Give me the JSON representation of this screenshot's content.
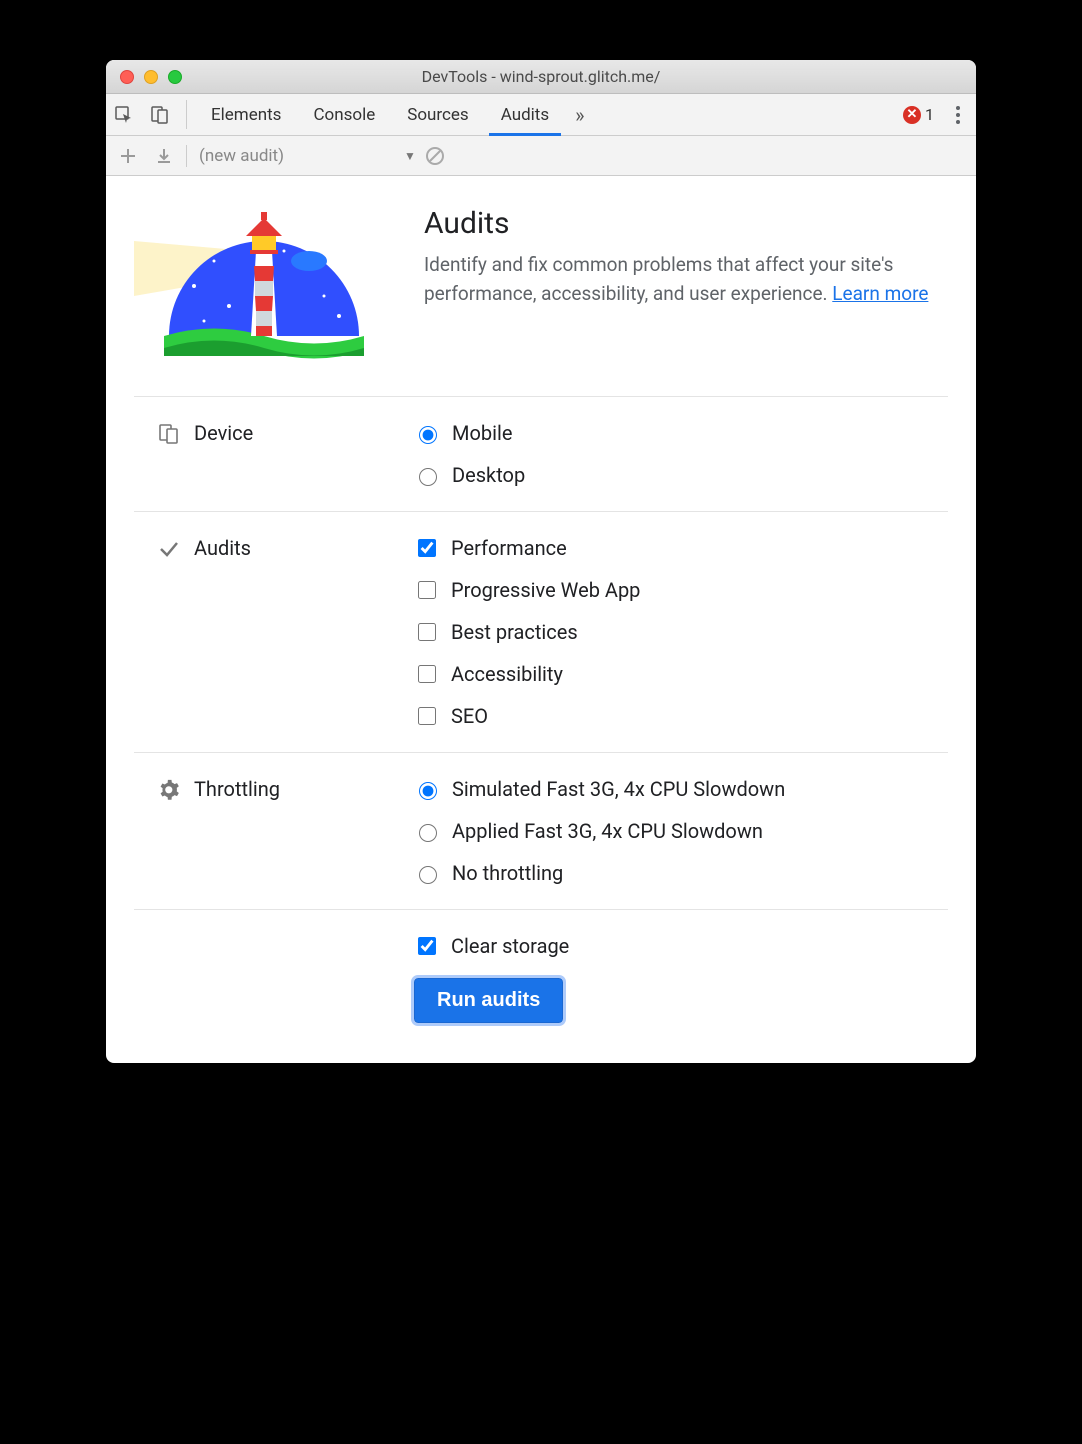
{
  "window": {
    "title": "DevTools - wind-sprout.glitch.me/"
  },
  "tabs": {
    "items": [
      "Elements",
      "Console",
      "Sources",
      "Audits"
    ],
    "active": "Audits",
    "more": "»",
    "error_count": "1"
  },
  "subbar": {
    "dropdown_label": "(new audit)"
  },
  "hero": {
    "title": "Audits",
    "description_prefix": "Identify and fix common problems that affect your site's performance, accessibility, and user experience. ",
    "learn_more": "Learn more"
  },
  "sections": {
    "device": {
      "label": "Device",
      "options": [
        {
          "label": "Mobile",
          "checked": true
        },
        {
          "label": "Desktop",
          "checked": false
        }
      ]
    },
    "audits": {
      "label": "Audits",
      "options": [
        {
          "label": "Performance",
          "checked": true
        },
        {
          "label": "Progressive Web App",
          "checked": false
        },
        {
          "label": "Best practices",
          "checked": false
        },
        {
          "label": "Accessibility",
          "checked": false
        },
        {
          "label": "SEO",
          "checked": false
        }
      ]
    },
    "throttling": {
      "label": "Throttling",
      "options": [
        {
          "label": "Simulated Fast 3G, 4x CPU Slowdown",
          "checked": true
        },
        {
          "label": "Applied Fast 3G, 4x CPU Slowdown",
          "checked": false
        },
        {
          "label": "No throttling",
          "checked": false
        }
      ]
    },
    "clear_storage": {
      "label": "Clear storage",
      "checked": true
    }
  },
  "run_button": "Run audits"
}
